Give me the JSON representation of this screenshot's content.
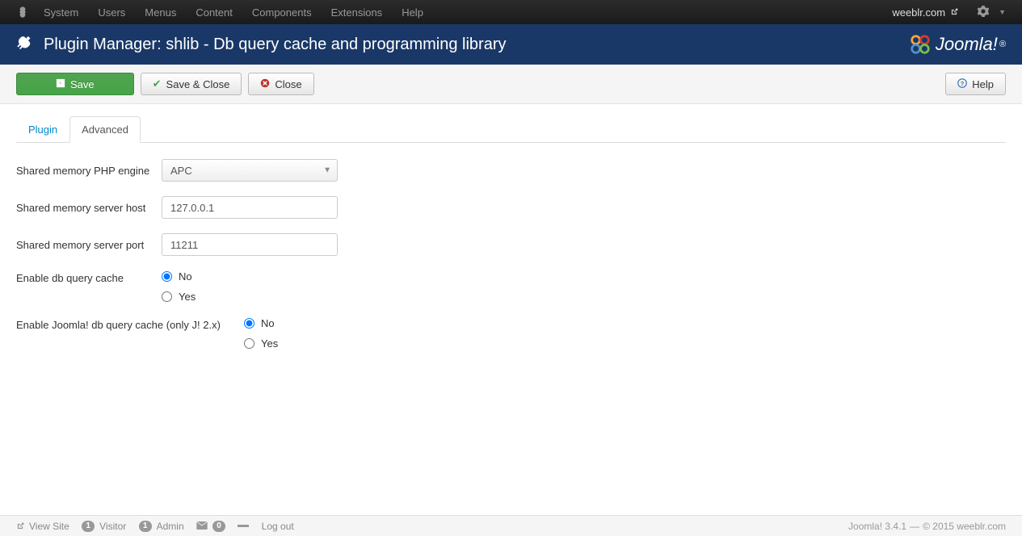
{
  "topnav": {
    "items": [
      "System",
      "Users",
      "Menus",
      "Content",
      "Components",
      "Extensions",
      "Help"
    ],
    "site": "weeblr.com"
  },
  "header": {
    "title": "Plugin Manager: shlib - Db query cache and programming library",
    "brand": "Joomla!"
  },
  "toolbar": {
    "save": "Save",
    "save_close": "Save & Close",
    "close": "Close",
    "help": "Help"
  },
  "tabs": {
    "plugin": "Plugin",
    "advanced": "Advanced"
  },
  "form": {
    "engine_label": "Shared memory PHP engine",
    "engine_value": "APC",
    "host_label": "Shared memory server host",
    "host_value": "127.0.0.1",
    "port_label": "Shared memory server port",
    "port_value": "11211",
    "cache_label": "Enable db query cache",
    "cache_no": "No",
    "cache_yes": "Yes",
    "jcache_label": "Enable Joomla! db query cache (only J! 2.x)",
    "jcache_no": "No",
    "jcache_yes": "Yes"
  },
  "footer": {
    "view_site": "View Site",
    "visitors_count": "1",
    "visitors_label": "Visitor",
    "admins_count": "1",
    "admins_label": "Admin",
    "msg_count": "0",
    "logout": "Log out",
    "version": "Joomla! 3.4.1",
    "copyright": "© 2015 weeblr.com"
  }
}
